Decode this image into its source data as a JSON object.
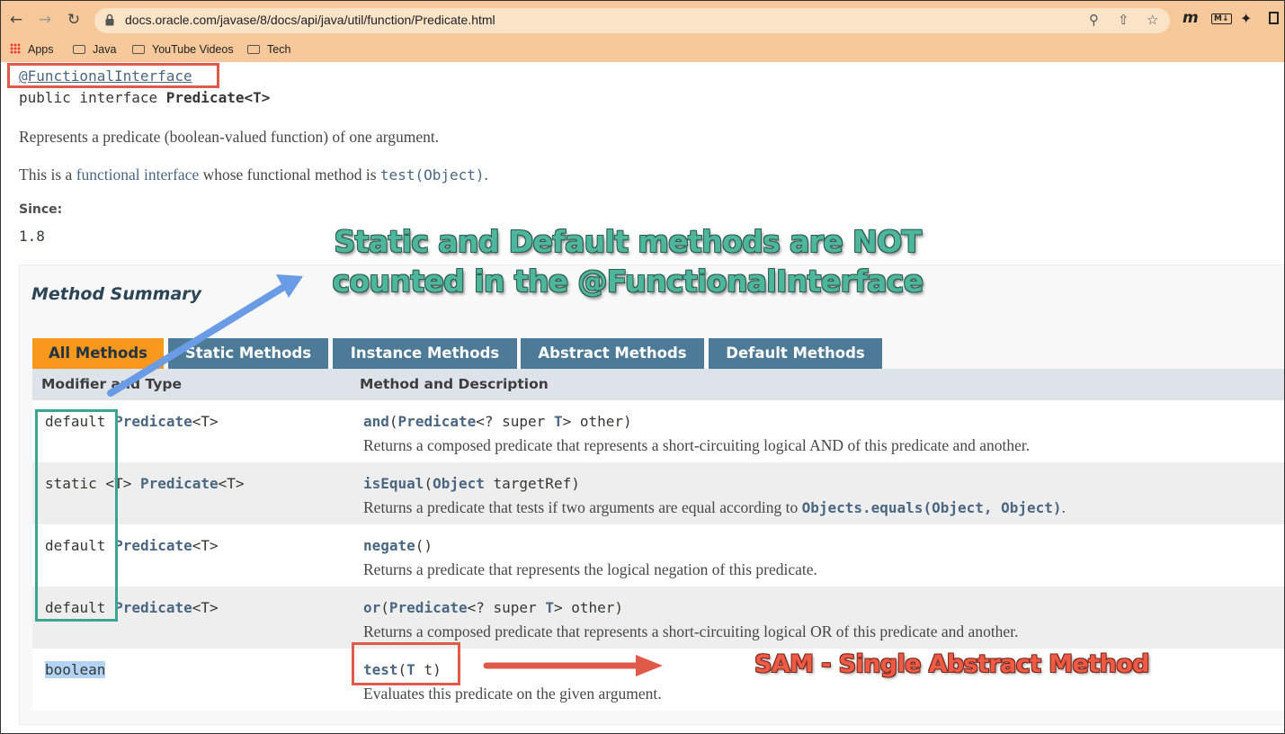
{
  "browser": {
    "url": "docs.oracle.com/javase/8/docs/api/java/util/function/Predicate.html",
    "bookmarks": [
      "Apps",
      "Java",
      "YouTube Videos",
      "Tech"
    ]
  },
  "page": {
    "annotation": "@FunctionalInterface",
    "declaration_prefix": "public interface ",
    "declaration_name": "Predicate<T>",
    "description": "Represents a predicate (boolean-valued function) of one argument.",
    "functional_prefix": "This is a ",
    "functional_link": "functional interface",
    "functional_middle": " whose functional method is ",
    "functional_method": "test(Object)",
    "functional_suffix": ".",
    "since_label": "Since:",
    "since_value": "1.8"
  },
  "summary": {
    "title": "Method Summary",
    "tabs": [
      "All Methods",
      "Static Methods",
      "Instance Methods",
      "Abstract Methods",
      "Default Methods"
    ],
    "headers": [
      "Modifier and Type",
      "Method and Description"
    ],
    "rows": [
      {
        "mod": "default ",
        "type": "Predicate",
        "type_suffix": "<T>",
        "method": "and",
        "sig_open": "(",
        "param_type": "Predicate",
        "sig_mid": "<? super ",
        "param_tvar": "T",
        "sig_end": "> other)",
        "desc": "Returns a composed predicate that represents a short-circuiting logical AND of this predicate and another."
      },
      {
        "mod": "static <T> ",
        "type": "Predicate",
        "type_suffix": "<T>",
        "method": "isEqual",
        "sig_open": "(",
        "param_type": "Object",
        "sig_end": " targetRef)",
        "desc_prefix": "Returns a predicate that tests if two arguments are equal according to ",
        "desc_code": "Objects.equals(Object, Object)",
        "desc_suffix": "."
      },
      {
        "mod": "default ",
        "type": "Predicate",
        "type_suffix": "<T>",
        "method": "negate",
        "sig_end": "()",
        "desc": "Returns a predicate that represents the logical negation of this predicate."
      },
      {
        "mod": "default ",
        "type": "Predicate",
        "type_suffix": "<T>",
        "method": "or",
        "sig_open": "(",
        "param_type": "Predicate",
        "sig_mid": "<? super ",
        "param_tvar": "T",
        "sig_end": "> other)",
        "desc": "Returns a composed predicate that represents a short-circuiting logical OR of this predicate and another."
      },
      {
        "mod": "boolean",
        "method": "test",
        "sig_open": "(",
        "param_tvar": "T",
        "sig_end": " t)",
        "desc": "Evaluates this predicate on the given argument."
      }
    ]
  },
  "callouts": {
    "green_line1": "Static and Default methods are NOT",
    "green_line2": "counted in the @FunctionalInterface",
    "red": "SAM - Single Abstract Method"
  },
  "colors": {
    "active_tab": "#f8981d",
    "tab": "#4d7a97",
    "link": "#4a6782",
    "green_callout": "#4db69c",
    "red_callout": "#ee5a44"
  }
}
